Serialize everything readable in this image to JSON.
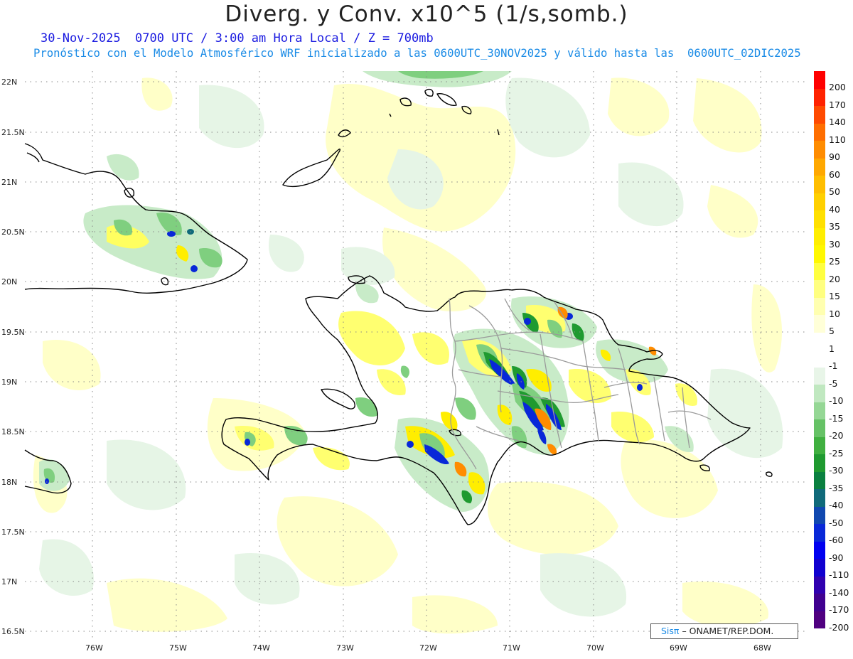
{
  "title": "Diverg. y Conv. x10^5 (1/s,somb.)",
  "subtitle_date": "30-Nov-2025  0700 UTC / 3:00 am Hora Local / Z = 700mb",
  "subtitle_model": "Pronóstico con el Modelo Atmosférico WRF inicializado a las 0600UTC_30NOV2025 y válido hasta las  0600UTC_02DIC2025",
  "lat_labels": [
    "22N",
    "21.5N",
    "21N",
    "20.5N",
    "20N",
    "19.5N",
    "19N",
    "18.5N",
    "18N",
    "17.5N",
    "17N",
    "16.5N"
  ],
  "lon_labels": [
    "76W",
    "75W",
    "74W",
    "73W",
    "72W",
    "71W",
    "70W",
    "69W",
    "68W"
  ],
  "colorbar": {
    "labels": [
      "200",
      "170",
      "140",
      "110",
      "90",
      "60",
      "50",
      "40",
      "35",
      "30",
      "25",
      "20",
      "15",
      "10",
      "5",
      "1",
      "-1",
      "-5",
      "-10",
      "-15",
      "-20",
      "-25",
      "-30",
      "-35",
      "-40",
      "-50",
      "-60",
      "-90",
      "-110",
      "-140",
      "-170",
      "-200"
    ],
    "colors": [
      "#ff0000",
      "#ff2200",
      "#ff4a00",
      "#ff6e00",
      "#ff8c00",
      "#ffa800",
      "#ffbe00",
      "#ffd000",
      "#ffe000",
      "#ffee00",
      "#fff800",
      "#ffff40",
      "#ffff80",
      "#ffffb0",
      "#ffffd8",
      "#ffffff",
      "#ffffff",
      "#e8f5e8",
      "#c0e8c0",
      "#95d795",
      "#66c266",
      "#40b040",
      "#1f9a30",
      "#0a8040",
      "#106a7a",
      "#1048b0",
      "#0828d8",
      "#0000f0",
      "#1000d0",
      "#3000b0",
      "#400090",
      "#500080"
    ]
  },
  "credit": {
    "brand": "Sisπ",
    "org": "– ONAMET/REP.DOM."
  },
  "colors": {
    "green_light": "#c8ebc8",
    "green_mid": "#7fcf7f",
    "green_dark": "#1f9a30",
    "yellow_light": "#ffffc0",
    "yellow": "#ffee00",
    "orange": "#ff8c00",
    "blue": "#0828d8",
    "boundary": "#000000",
    "province": "#999999"
  }
}
